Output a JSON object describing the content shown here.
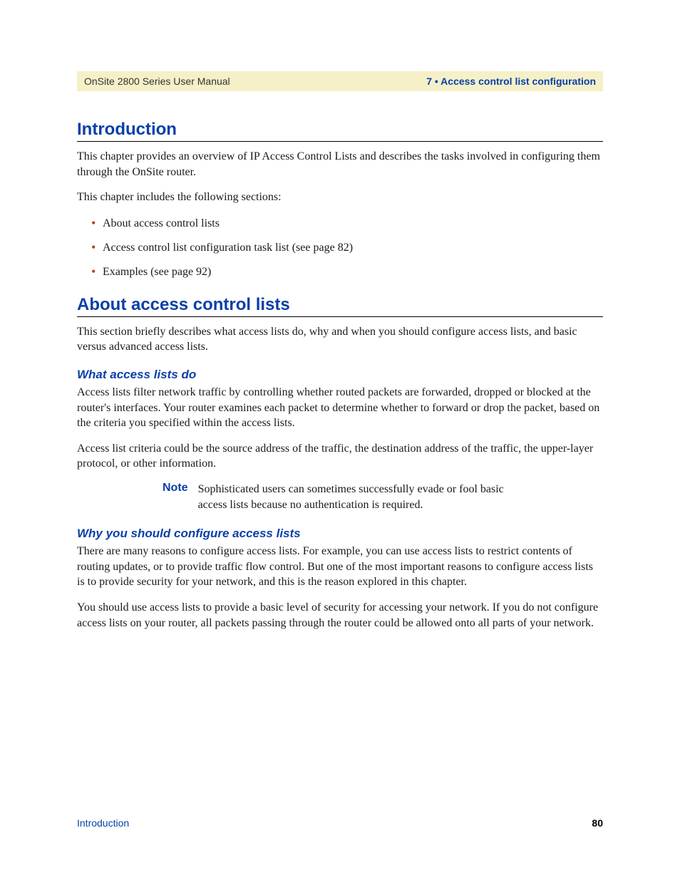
{
  "header": {
    "left": "OnSite 2800 Series User Manual",
    "right": "7 • Access control list configuration"
  },
  "sections": {
    "introduction": {
      "heading": "Introduction",
      "p1": "This chapter provides an overview of IP Access Control Lists and describes the tasks involved in configuring them through the OnSite router.",
      "p2": "This chapter includes the following sections:",
      "bullets": [
        "About access control lists",
        "Access control list configuration task list (see page 82)",
        "Examples (see page 92)"
      ]
    },
    "about": {
      "heading": "About access control lists",
      "p1": "This section briefly describes what access lists do, why and when you should configure access lists, and basic versus advanced access lists."
    },
    "what": {
      "heading": "What access lists do",
      "p1": "Access lists filter network traffic by controlling whether routed packets are forwarded, dropped or blocked at the router's interfaces. Your router examines each packet to determine whether to forward or drop the packet, based on the criteria you specified within the access lists.",
      "p2": "Access list criteria could be the source address of the traffic, the destination address of the traffic, the upper-layer protocol, or other information.",
      "note_label": "Note",
      "note_text": "Sophisticated users can sometimes successfully evade or fool basic access lists because no authentication is required."
    },
    "why": {
      "heading": "Why you should configure access lists",
      "p1": "There are many reasons to configure access lists. For example, you can use access lists to restrict contents of routing updates, or to provide traffic flow control. But one of the most important reasons to configure access lists is to provide security for your network, and this is the reason explored in this chapter.",
      "p2": "You should use access lists to provide a basic level of security for accessing your network. If you do not configure access lists on your router, all packets passing through the router could be allowed onto all parts of your network."
    }
  },
  "footer": {
    "left": "Introduction",
    "right": "80"
  }
}
